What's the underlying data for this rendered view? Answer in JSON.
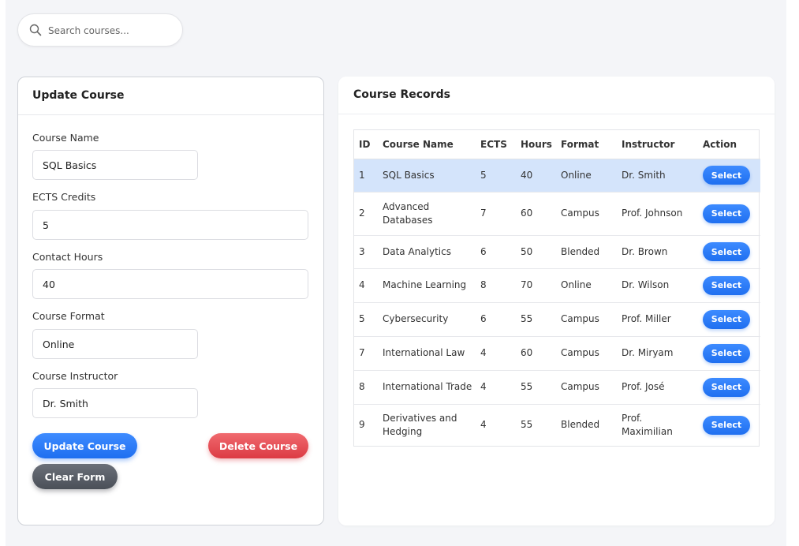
{
  "search": {
    "placeholder": "Search courses..."
  },
  "form": {
    "title": "Update Course",
    "fields": {
      "course_name": {
        "label": "Course Name",
        "value": "SQL Basics"
      },
      "ects": {
        "label": "ECTS Credits",
        "value": "5"
      },
      "hours": {
        "label": "Contact Hours",
        "value": "40"
      },
      "format": {
        "label": "Course Format",
        "value": "Online"
      },
      "instructor": {
        "label": "Course Instructor",
        "value": "Dr. Smith"
      }
    },
    "buttons": {
      "update": "Update Course",
      "delete": "Delete Course",
      "clear": "Clear Form"
    }
  },
  "records": {
    "title": "Course Records",
    "columns": [
      "ID",
      "Course Name",
      "ECTS",
      "Hours",
      "Format",
      "Instructor",
      "Action"
    ],
    "select_label": "Select",
    "selected_row": 0,
    "rows": [
      {
        "id": "1",
        "name": "SQL Basics",
        "ects": "5",
        "hours": "40",
        "format": "Online",
        "instructor": "Dr. Smith"
      },
      {
        "id": "2",
        "name": "Advanced Databases",
        "ects": "7",
        "hours": "60",
        "format": "Campus",
        "instructor": "Prof. Johnson"
      },
      {
        "id": "3",
        "name": "Data Analytics",
        "ects": "6",
        "hours": "50",
        "format": "Blended",
        "instructor": "Dr. Brown"
      },
      {
        "id": "4",
        "name": "Machine Learning",
        "ects": "8",
        "hours": "70",
        "format": "Online",
        "instructor": "Dr. Wilson"
      },
      {
        "id": "5",
        "name": "Cybersecurity",
        "ects": "6",
        "hours": "55",
        "format": "Campus",
        "instructor": "Prof. Miller"
      },
      {
        "id": "7",
        "name": "International Law",
        "ects": "4",
        "hours": "60",
        "format": "Campus",
        "instructor": "Dr. Miryam"
      },
      {
        "id": "8",
        "name": "International Trade",
        "ects": "4",
        "hours": "55",
        "format": "Campus",
        "instructor": "Prof. José"
      },
      {
        "id": "9",
        "name": "Derivatives and Hedging",
        "ects": "4",
        "hours": "55",
        "format": "Blended",
        "instructor": "Prof. Maximilian"
      }
    ]
  },
  "colors": {
    "primary": "#2a7bf6",
    "danger": "#e5484f",
    "neutral": "#5a5f67",
    "selected_row": "#d4e4fb"
  },
  "icons": {
    "search": "search-icon"
  }
}
